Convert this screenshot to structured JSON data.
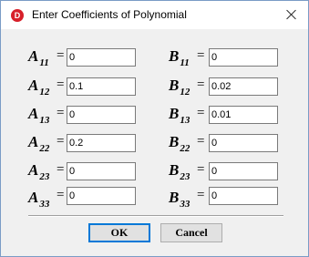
{
  "window": {
    "title": "Enter Coefficients of Polynomial",
    "icon": "app-logo-icon",
    "icon_glyph": "D",
    "close_glyph": "close-icon"
  },
  "coefficients": {
    "A11": {
      "letter": "A",
      "sub": "11",
      "eq": "=",
      "value": "0"
    },
    "A12": {
      "letter": "A",
      "sub": "12",
      "eq": "=",
      "value": "0.1"
    },
    "A13": {
      "letter": "A",
      "sub": "13",
      "eq": "=",
      "value": "0"
    },
    "A22": {
      "letter": "A",
      "sub": "22",
      "eq": "=",
      "value": "0.2"
    },
    "A23": {
      "letter": "A",
      "sub": "23",
      "eq": "=",
      "value": "0"
    },
    "A33": {
      "letter": "A",
      "sub": "33",
      "eq": "=",
      "value": "0"
    },
    "B11": {
      "letter": "B",
      "sub": "11",
      "eq": "=",
      "value": "0"
    },
    "B12": {
      "letter": "B",
      "sub": "12",
      "eq": "=",
      "value": "0.02"
    },
    "B13": {
      "letter": "B",
      "sub": "13",
      "eq": "=",
      "value": "0.01"
    },
    "B22": {
      "letter": "B",
      "sub": "22",
      "eq": "=",
      "value": "0"
    },
    "B23": {
      "letter": "B",
      "sub": "23",
      "eq": "=",
      "value": "0"
    },
    "B33": {
      "letter": "B",
      "sub": "33",
      "eq": "=",
      "value": "0"
    }
  },
  "buttons": {
    "ok": "OK",
    "cancel": "Cancel"
  }
}
